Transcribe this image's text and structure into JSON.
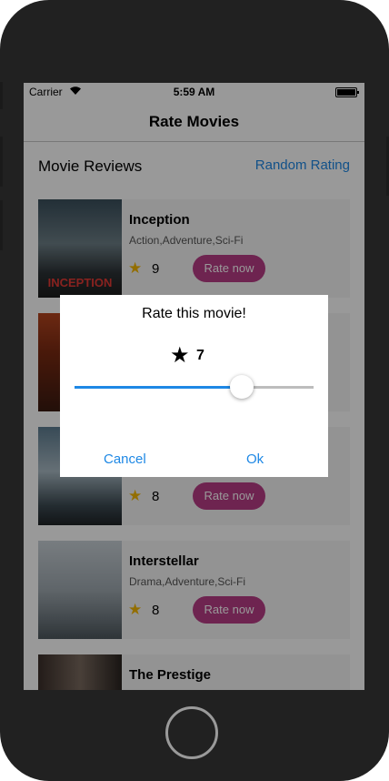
{
  "status_bar": {
    "carrier": "Carrier",
    "time": "5:59 AM"
  },
  "nav": {
    "title": "Rate Movies"
  },
  "header": {
    "title": "Movie Reviews",
    "random_link": "Random Rating"
  },
  "movies": [
    {
      "title": "Inception",
      "genre": "Action,Adventure,Sci-Fi",
      "rating": "9",
      "button": "Rate now",
      "poster_text": "INCEPTION"
    },
    {
      "title": "",
      "genre": "",
      "rating": "",
      "button": ""
    },
    {
      "title": "",
      "genre": "",
      "rating": "8",
      "button": "Rate now"
    },
    {
      "title": "Interstellar",
      "genre": "Drama,Adventure,Sci-Fi",
      "rating": "8",
      "button": "Rate now"
    },
    {
      "title": "The Prestige",
      "genre": "",
      "rating": "",
      "button": ""
    }
  ],
  "dialog": {
    "title": "Rate this movie!",
    "value": "7",
    "slider_fraction": 0.7,
    "cancel": "Cancel",
    "ok": "Ok"
  },
  "colors": {
    "accent": "#1e88e5",
    "rate_button": "#b83c86",
    "star": "#f5b700"
  }
}
